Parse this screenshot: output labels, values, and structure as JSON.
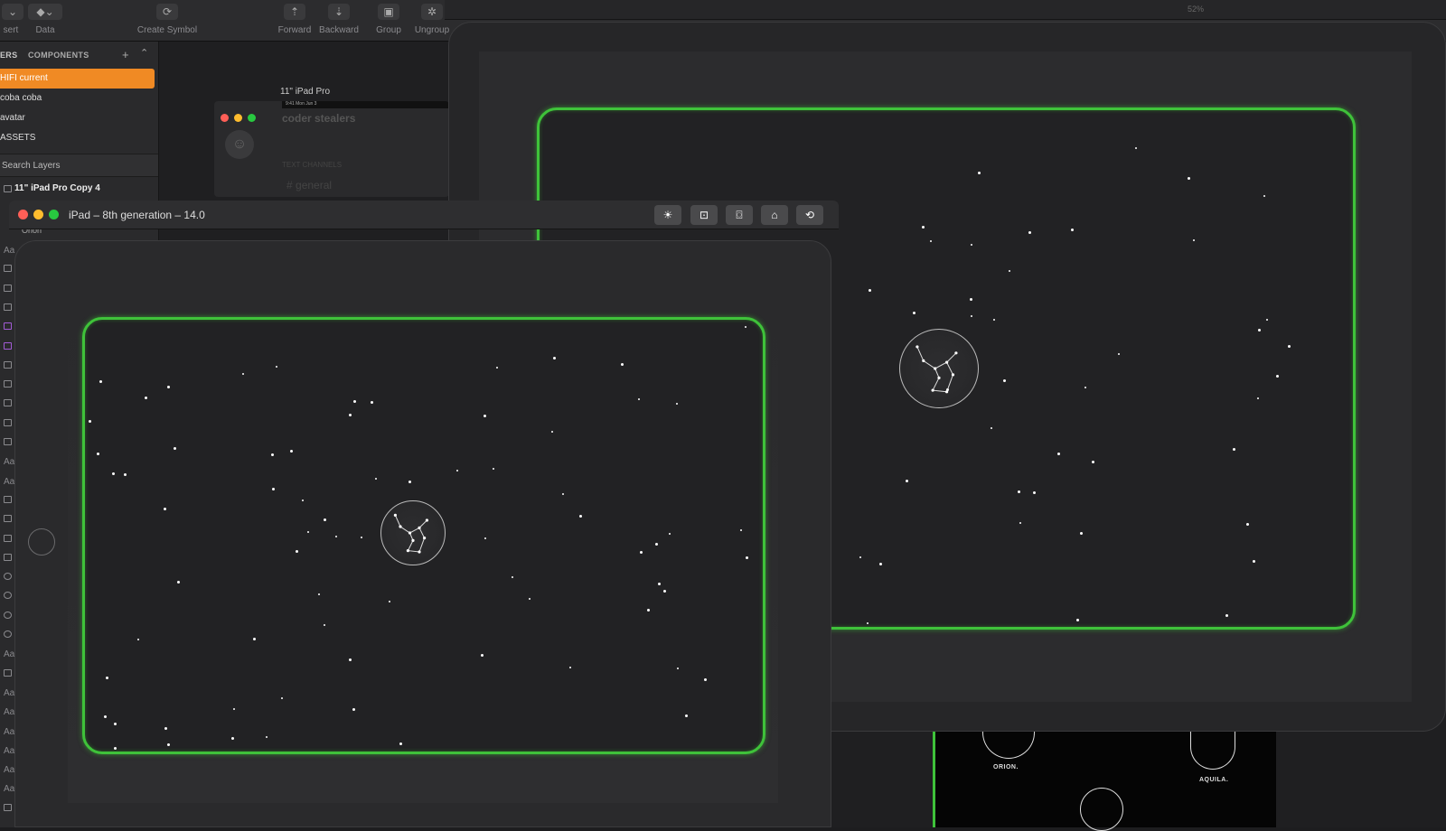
{
  "toolbar": {
    "items": [
      {
        "label": "sert",
        "icon": "chevron-down-icon"
      },
      {
        "label": "Data",
        "icon": "data-icon"
      },
      {
        "label": "Create Symbol",
        "icon": "symbol-icon"
      },
      {
        "label": "Forward",
        "icon": "forward-icon"
      },
      {
        "label": "Backward",
        "icon": "backward-icon"
      },
      {
        "label": "Group",
        "icon": "group-icon"
      },
      {
        "label": "Ungroup",
        "icon": "ungroup-icon"
      }
    ],
    "zoom": "52%"
  },
  "sidebar": {
    "tab_layers": "ERS",
    "tab_components": "COMPONENTS",
    "pages": [
      "HIFI current",
      "coba coba",
      "avatar",
      "ASSETS"
    ],
    "selected_page": "HIFI current",
    "search_placeholder": "Search Layers",
    "artboard": "11\" iPad Pro Copy 4",
    "layer_label": "Orion"
  },
  "canvas": {
    "artboard_label": "11\" iPad Pro",
    "mini_time": "9:41  Mon Jun 3",
    "discord_title": "coder stealers",
    "text_channels": "TEXT CHANNELS",
    "channel": "general",
    "constellations": [
      "ORION.",
      "AQUILA."
    ]
  },
  "simulator": {
    "title": "iPad – 8th generation – 14.0",
    "buttons": [
      "brightness-icon",
      "screenshot-frame-icon",
      "camera-icon",
      "home-icon",
      "rotate-icon"
    ]
  },
  "colors": {
    "accent_orange": "#f08a24",
    "glow_green": "#3fc23a",
    "traffic_red": "#ff5f57",
    "traffic_yellow": "#febc2e",
    "traffic_green": "#28c840"
  }
}
